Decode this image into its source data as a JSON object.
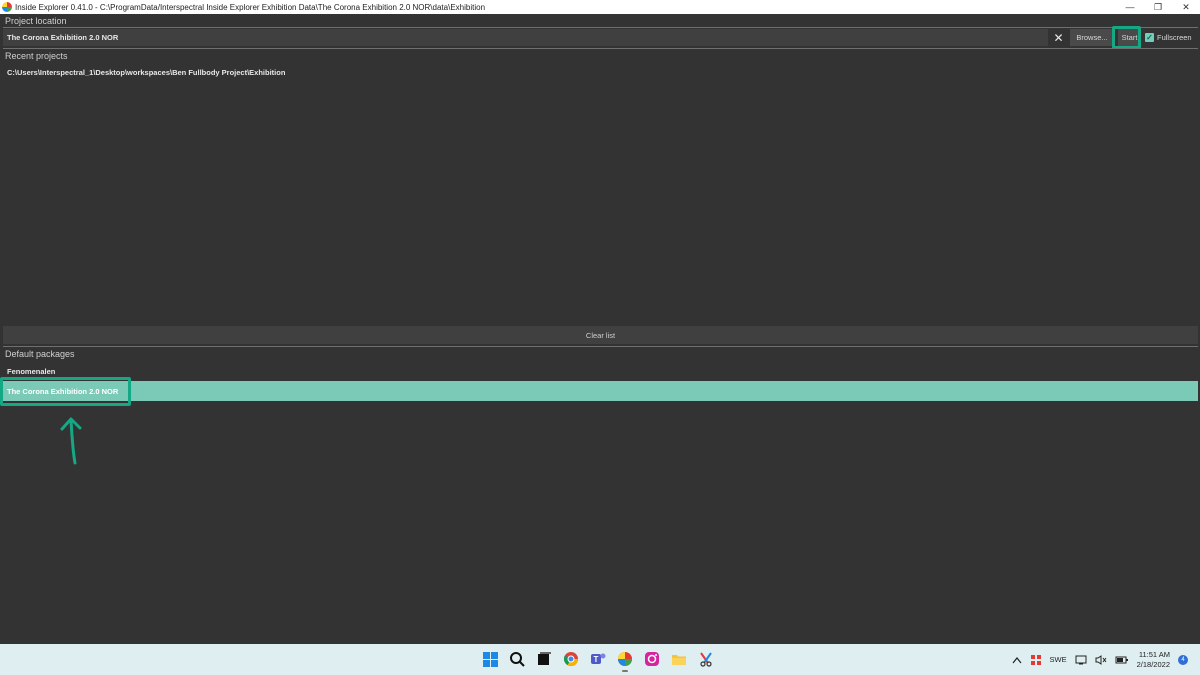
{
  "window": {
    "title": "Inside Explorer 0.41.0 - C:\\ProgramData/Interspectral Inside Explorer Exhibition Data\\The Corona Exhibition 2.0 NOR\\data\\Exhibition",
    "controls": {
      "minimize": "—",
      "restore": "❐",
      "close": "✕"
    }
  },
  "project_location": {
    "label": "Project location",
    "value": "The Corona Exhibition 2.0 NOR",
    "clear_icon": "✕",
    "browse_label": "Browse...",
    "start_label": "Start",
    "fullscreen_label": "Fullscreen",
    "fullscreen_checked": true
  },
  "recent_projects": {
    "label": "Recent projects",
    "items": [
      "C:\\Users\\Interspectral_1\\Desktop\\workspaces\\Ben Fullbody Project\\Exhibition"
    ],
    "clear_label": "Clear list"
  },
  "default_packages": {
    "label": "Default packages",
    "items": [
      {
        "label": "Fenomenalen",
        "selected": false
      },
      {
        "label": "The Corona Exhibition 2.0 NOR",
        "selected": true
      }
    ]
  },
  "annotation": {
    "color": "#14a884"
  },
  "taskbar": {
    "apps": [
      "windows-start-icon",
      "search-icon",
      "task-view-icon",
      "chrome-icon",
      "teams-icon",
      "inside-explorer-icon",
      "instagram-icon",
      "file-explorer-icon",
      "snipping-tool-icon"
    ],
    "tray": {
      "chevron": "^",
      "language": "SWE",
      "time": "11:51 AM",
      "date": "2/18/2022",
      "notifications": "4"
    }
  },
  "colors": {
    "background": "#333333",
    "selected_row": "#7bcab7",
    "taskbar": "#dfeef0"
  }
}
